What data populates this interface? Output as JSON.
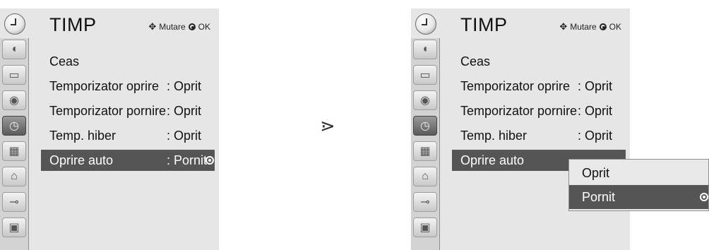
{
  "menu_title": "TIMP",
  "nav_hint": {
    "move_label": "Mutare",
    "ok_label": "OK",
    "move_icon": "four-way-arrow-icon",
    "ok_icon": "ok-button-icon"
  },
  "left_panel": {
    "items": [
      {
        "label": "Ceas",
        "value": ""
      },
      {
        "label": "Temporizator oprire",
        "value": ": Oprit"
      },
      {
        "label": "Temporizator pornire",
        "value": ": Oprit"
      },
      {
        "label": "Temp. hiber",
        "value": ": Oprit"
      },
      {
        "label": "Oprire auto",
        "value": ": Pornit",
        "selected": true
      }
    ]
  },
  "right_panel": {
    "items": [
      {
        "label": "Ceas",
        "value": ""
      },
      {
        "label": "Temporizator oprire",
        "value": ": Oprit"
      },
      {
        "label": "Temporizator pornire",
        "value": ": Oprit"
      },
      {
        "label": "Temp. hiber",
        "value": ": Oprit"
      },
      {
        "label": "Oprire auto",
        "value": "",
        "selected": true
      }
    ],
    "popup_options": [
      {
        "label": "Oprit",
        "selected": false
      },
      {
        "label": "Pornit",
        "selected": true
      }
    ]
  },
  "sidebar_icons": [
    "satellite-dish-icon",
    "monitor-icon",
    "speaker-icon",
    "clock-icon",
    "calendar-icon",
    "lock-icon",
    "input-plug-icon",
    "photo-icon"
  ],
  "step_arrow": "⋗",
  "colors": {
    "panel_bg": "#e6e6e6",
    "selected_bg": "#555555",
    "selected_text": "#ffffff"
  }
}
